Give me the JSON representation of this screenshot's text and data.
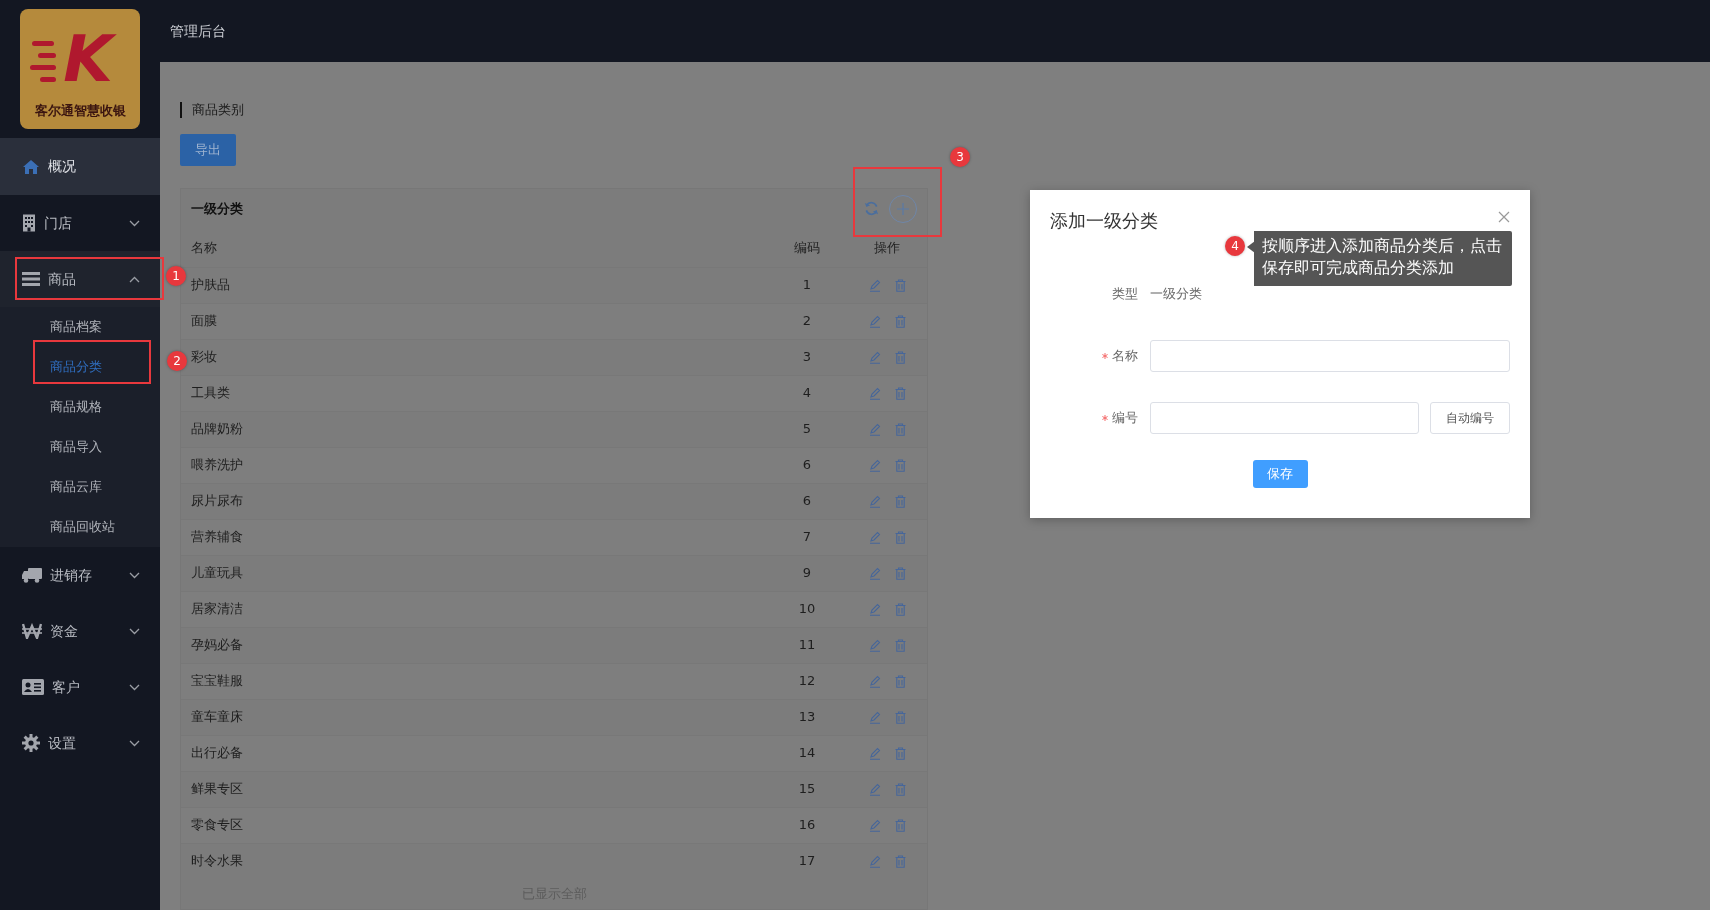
{
  "logo": {
    "mark": "K",
    "name": "客尔通智慧收银"
  },
  "header": {
    "title": "管理后台"
  },
  "sidebar": {
    "items": [
      {
        "label": "概况",
        "kind": "link",
        "selected": true
      },
      {
        "label": "门店",
        "kind": "menu",
        "selected": false,
        "expanded": false
      },
      {
        "label": "商品",
        "kind": "menu",
        "selected": false,
        "expanded": true,
        "children": [
          {
            "label": "商品档案",
            "selected": false
          },
          {
            "label": "商品分类",
            "selected": true
          },
          {
            "label": "商品规格",
            "selected": false
          },
          {
            "label": "商品导入",
            "selected": false
          },
          {
            "label": "商品云库",
            "selected": false
          },
          {
            "label": "商品回收站",
            "selected": false
          }
        ]
      },
      {
        "label": "进销存",
        "kind": "menu",
        "selected": false,
        "expanded": false
      },
      {
        "label": "资金",
        "kind": "menu",
        "selected": false,
        "expanded": false
      },
      {
        "label": "客户",
        "kind": "menu",
        "selected": false,
        "expanded": false
      },
      {
        "label": "设置",
        "kind": "menu",
        "selected": false,
        "expanded": false
      }
    ]
  },
  "page": {
    "title": "商品类别",
    "export_button": "导出"
  },
  "category_card": {
    "title": "一级分类",
    "columns": [
      "名称",
      "编码",
      "操作"
    ],
    "rows": [
      {
        "name": "护肤品",
        "code": "1"
      },
      {
        "name": "面膜",
        "code": "2"
      },
      {
        "name": "彩妆",
        "code": "3"
      },
      {
        "name": "工具类",
        "code": "4"
      },
      {
        "name": "品牌奶粉",
        "code": "5"
      },
      {
        "name": "喂养洗护",
        "code": "6"
      },
      {
        "name": "尿片尿布",
        "code": "6"
      },
      {
        "name": "营养辅食",
        "code": "7"
      },
      {
        "name": "儿童玩具",
        "code": "9"
      },
      {
        "name": "居家清洁",
        "code": "10"
      },
      {
        "name": "孕妈必备",
        "code": "11"
      },
      {
        "name": "宝宝鞋服",
        "code": "12"
      },
      {
        "name": "童车童床",
        "code": "13"
      },
      {
        "name": "出行必备",
        "code": "14"
      },
      {
        "name": "鲜果专区",
        "code": "15"
      },
      {
        "name": "零食专区",
        "code": "16"
      },
      {
        "name": "时令水果",
        "code": "17"
      }
    ],
    "footer": "已显示全部"
  },
  "modal": {
    "title": "添加一级分类",
    "fields": [
      {
        "kind": "static",
        "label": "类型",
        "value": "一级分类"
      },
      {
        "kind": "input",
        "label": "名称",
        "required": true
      },
      {
        "kind": "input_button",
        "label": "编号",
        "required": true,
        "button": "自动编号"
      }
    ],
    "save_button": "保存"
  },
  "annotations": [
    {
      "kind": "box",
      "number": "1"
    },
    {
      "kind": "box",
      "number": "2"
    },
    {
      "kind": "box",
      "number": "3"
    },
    {
      "kind": "tip",
      "number": "4",
      "note": "按顺序进入添加商品分类后，点击保存即可完成商品分类添加"
    }
  ]
}
